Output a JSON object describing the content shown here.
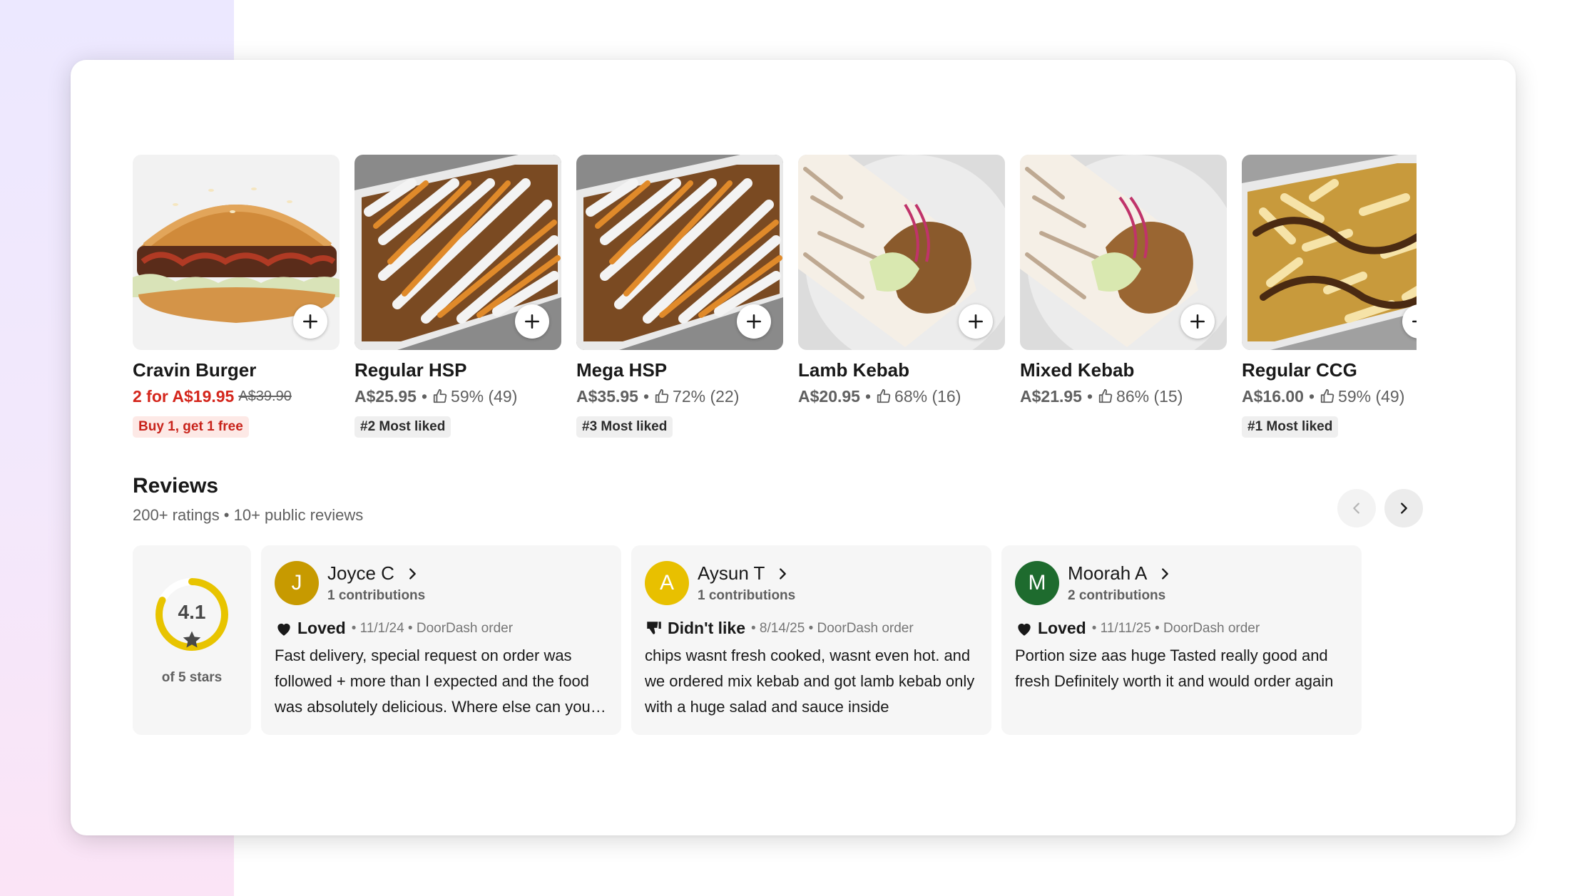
{
  "menu_items": [
    {
      "name": "Cravin Burger",
      "price": "2 for A$19.95",
      "old_price": "A$39.90",
      "rating": "",
      "badge": "Buy 1, get 1 free",
      "image": "burger"
    },
    {
      "name": "Regular HSP",
      "price": "A$25.95",
      "rating": "59% (49)",
      "badge": "#2 Most liked",
      "image": "hsp"
    },
    {
      "name": "Mega HSP",
      "price": "A$35.95",
      "rating": "72% (22)",
      "badge": "#3 Most liked",
      "image": "hsp"
    },
    {
      "name": "Lamb Kebab",
      "price": "A$20.95",
      "rating": "68% (16)",
      "badge": "",
      "image": "kebab"
    },
    {
      "name": "Mixed Kebab",
      "price": "A$21.95",
      "rating": "86% (15)",
      "badge": "",
      "image": "kebab"
    },
    {
      "name": "Regular CCG",
      "price": "A$16.00",
      "rating": "59% (49)",
      "badge": "#1 Most liked",
      "image": "chips"
    }
  ],
  "reviews": {
    "title": "Reviews",
    "subtitle": "200+ ratings • 10+ public reviews",
    "rating": {
      "value": "4.1",
      "fraction": 0.82,
      "label": "of 5 stars",
      "color": "#e8c400"
    },
    "items": [
      {
        "initial": "J",
        "name": "Joyce C",
        "contributions": "1 contributions",
        "verdict": "Loved",
        "verdict_icon": "heart-icon",
        "meta": "• 11/1/24 • DoorDash order",
        "text": "Fast delivery, special request on order was followed + more than I expected and the food was absolutely delicious. Where else can you get that quality",
        "avatar_color": "#c79a00"
      },
      {
        "initial": "A",
        "name": "Aysun T",
        "contributions": "1 contributions",
        "verdict": "Didn't like",
        "verdict_icon": "thumbs-down-icon",
        "meta": "• 8/14/25 • DoorDash order",
        "text": "chips wasnt fresh cooked, wasnt even hot. and we ordered mix kebab and got lamb kebab only with a huge salad and sauce inside",
        "avatar_color": "#e8c000"
      },
      {
        "initial": "M",
        "name": "Moorah A",
        "contributions": "2 contributions",
        "verdict": "Loved",
        "verdict_icon": "heart-icon",
        "meta": "• 11/11/25 • DoorDash order",
        "text": "Portion size aas huge Tasted really good and fresh Definitely worth it and would order again",
        "avatar_color": "#1e6b2e"
      }
    ]
  },
  "colors": {
    "deal_red": "#d4261c",
    "text_dark": "#191919",
    "text_muted": "#606060"
  }
}
